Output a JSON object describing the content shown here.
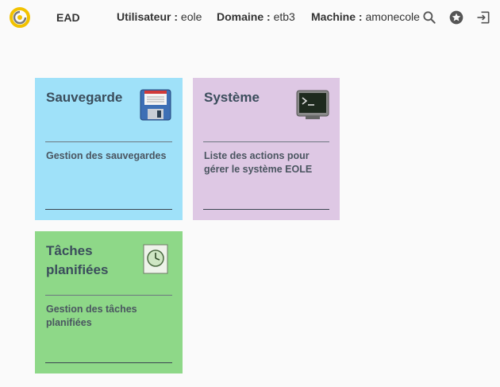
{
  "header": {
    "app_name": "EAD",
    "user_label": "Utilisateur :",
    "user_value": "eole",
    "domain_label": "Domaine :",
    "domain_value": "etb3",
    "machine_label": "Machine :",
    "machine_value": "amonecole",
    "icons": [
      "search-icon",
      "star-icon",
      "logout-icon"
    ]
  },
  "tiles": [
    {
      "title": "Sauvegarde",
      "description": "Gestion des sauvegardes",
      "color": "#9fe1f9",
      "icon": "floppy-disk-icon"
    },
    {
      "title": "Système",
      "description": "Liste des actions pour gérer le système EOLE",
      "color": "#dec8e4",
      "icon": "terminal-icon"
    },
    {
      "title": "Tâches planifiées",
      "description": "Gestion des tâches planifiées",
      "color": "#8ed888",
      "icon": "clock-icon"
    }
  ],
  "colors": {
    "logo_yellow": "#f2c200",
    "logo_grey": "#7a7a7a"
  }
}
